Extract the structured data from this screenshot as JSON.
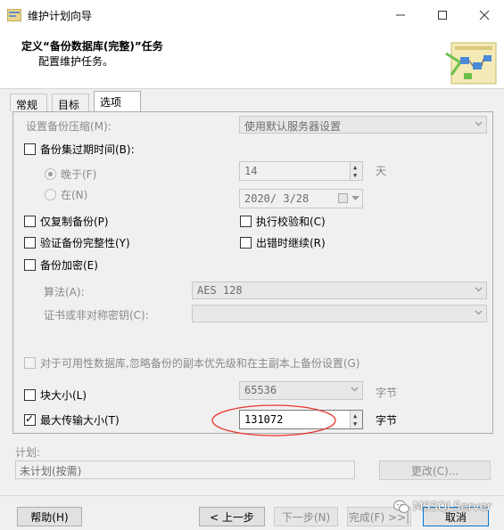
{
  "window": {
    "title": "维护计划向导"
  },
  "header": {
    "title": "定义“备份数据库(完整)”任务",
    "subtitle": "配置维护任务。"
  },
  "tabs": [
    {
      "label": "常规"
    },
    {
      "label": "目标"
    },
    {
      "label": "选项"
    }
  ],
  "options": {
    "compression": {
      "label": "设置备份压缩(M):",
      "value": "使用默认服务器设置"
    },
    "expire": {
      "label": "备份集过期时间(B):",
      "checked": false,
      "after": {
        "label": "晚于(F)",
        "value": "14",
        "unit": "天"
      },
      "on": {
        "label": "在(N)",
        "value": "2020/ 3/28"
      }
    },
    "copy_only": {
      "label": "仅复制备份(P)",
      "checked": false
    },
    "verify": {
      "label": "验证备份完整性(Y)",
      "checked": false
    },
    "encrypt": {
      "label": "备份加密(E)",
      "checked": false
    },
    "checksum": {
      "label": "执行校验和(C)",
      "checked": false
    },
    "continue_on_error": {
      "label": "出错时继续(R)",
      "checked": false
    },
    "algorithm": {
      "label": "算法(A):",
      "value": "AES 128"
    },
    "certificate": {
      "label": "证书或非对称密钥(C):",
      "value": ""
    },
    "availability": {
      "label": "对于可用性数据库,忽略备份的副本优先级和在主副本上备份设置(G)",
      "checked": false
    },
    "block_size": {
      "label": "块大小(L)",
      "value": "65536",
      "unit": "字节",
      "checked": false
    },
    "max_transfer": {
      "label": "最大传输大小(T)",
      "value": "131072",
      "unit": "字节",
      "checked": true
    }
  },
  "schedule": {
    "label": "计划:",
    "value": "未计划(按需)",
    "change_button": "更改(C)..."
  },
  "footer": {
    "help": "帮助(H)",
    "back": "< 上一步",
    "next": "下一步(N)",
    "finish": "完成(F) >>|",
    "cancel": "取消"
  },
  "watermark": "MSSQLServer",
  "colors": {
    "annotation": "#e8352d",
    "focus": "#0078d7"
  }
}
